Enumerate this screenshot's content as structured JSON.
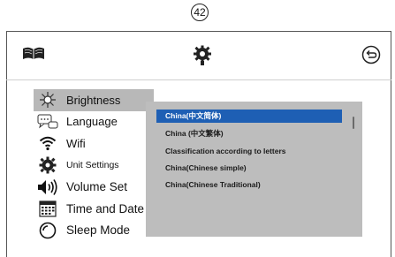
{
  "page_number": "42",
  "menu": {
    "items": [
      {
        "label": "Brightness",
        "icon": "brightness-icon",
        "selected": true
      },
      {
        "label": "Language",
        "icon": "speech-bubble-icon",
        "selected": false
      },
      {
        "label": "Wifi",
        "icon": "wifi-icon",
        "selected": false
      },
      {
        "label": "Unit Settings",
        "icon": "gear-icon",
        "selected": false
      },
      {
        "label": "Volume Set",
        "icon": "speaker-icon",
        "selected": false
      },
      {
        "label": "Time and Date",
        "icon": "calendar-icon",
        "selected": false
      },
      {
        "label": "Sleep Mode",
        "icon": "clock-icon",
        "selected": false
      }
    ]
  },
  "submenu": {
    "items": [
      {
        "label": "China(中文简体)",
        "active": true
      },
      {
        "label": "China (中文繁体)",
        "active": false
      },
      {
        "label": "Classification according to letters",
        "active": false
      },
      {
        "label": "China(Chinese simple)",
        "active": false
      },
      {
        "label": "China(Chinese Traditional)",
        "active": false
      }
    ]
  },
  "colors": {
    "selected_menu_bg": "#b8b8b8",
    "submenu_bg": "#bdbdbd",
    "active_item_bg": "#1e5fb4"
  }
}
